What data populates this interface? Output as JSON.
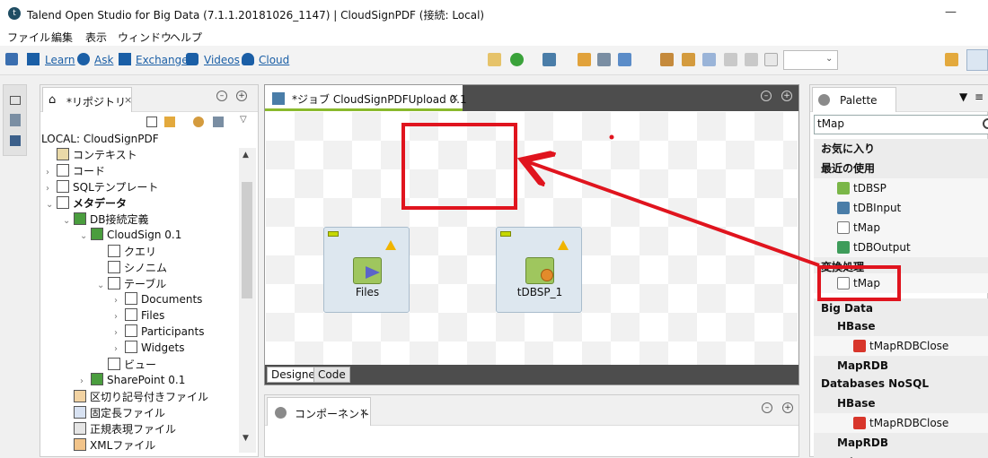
{
  "window": {
    "title": "Talend Open Studio for Big Data (7.1.1.20181026_1147) | CloudSignPDF (接続: Local)"
  },
  "menu": [
    "ファイル",
    "編集",
    "表示",
    "ウィンドウ",
    "ヘルプ"
  ],
  "toolbar": {
    "links": [
      "Learn",
      "Ask",
      "Exchange",
      "Videos",
      "Cloud"
    ]
  },
  "repository": {
    "tab_label": "*リポジトリ",
    "connection": "LOCAL: CloudSignPDF",
    "items": [
      {
        "label": "コンテキスト",
        "indent": 0,
        "arrow": "",
        "icon": "context-icon"
      },
      {
        "label": "コード",
        "indent": 0,
        "arrow": "›",
        "icon": "code-icon"
      },
      {
        "label": "SQLテンプレート",
        "indent": 0,
        "arrow": "›",
        "icon": "sql-template-icon"
      },
      {
        "label": "メタデータ",
        "indent": 0,
        "arrow": "⌄",
        "icon": "metadata-icon",
        "bold": true
      },
      {
        "label": "DB接続定義",
        "indent": 1,
        "arrow": "⌄",
        "icon": "db-connection-icon"
      },
      {
        "label": "CloudSign 0.1",
        "indent": 2,
        "arrow": "⌄",
        "icon": "db-connection-icon"
      },
      {
        "label": "クエリ",
        "indent": 3,
        "arrow": "",
        "icon": "folder-icon"
      },
      {
        "label": "シノニム",
        "indent": 3,
        "arrow": "",
        "icon": "folder-icon"
      },
      {
        "label": "テーブル",
        "indent": 3,
        "arrow": "⌄",
        "icon": "folder-icon"
      },
      {
        "label": "Documents",
        "indent": 4,
        "arrow": "›",
        "icon": "table-icon"
      },
      {
        "label": "Files",
        "indent": 4,
        "arrow": "›",
        "icon": "table-icon"
      },
      {
        "label": "Participants",
        "indent": 4,
        "arrow": "›",
        "icon": "table-icon"
      },
      {
        "label": "Widgets",
        "indent": 4,
        "arrow": "›",
        "icon": "table-icon"
      },
      {
        "label": "ビュー",
        "indent": 3,
        "arrow": "",
        "icon": "folder-icon"
      },
      {
        "label": "SharePoint 0.1",
        "indent": 2,
        "arrow": "›",
        "icon": "db-connection-icon"
      },
      {
        "label": "区切り記号付きファイル",
        "indent": 1,
        "arrow": "",
        "icon": "delimited-file-icon"
      },
      {
        "label": "固定長ファイル",
        "indent": 1,
        "arrow": "",
        "icon": "positional-file-icon"
      },
      {
        "label": "正規表現ファイル",
        "indent": 1,
        "arrow": "",
        "icon": "regex-file-icon"
      },
      {
        "label": "XMLファイル",
        "indent": 1,
        "arrow": "",
        "icon": "xml-file-icon"
      }
    ]
  },
  "editor": {
    "tab_label": "*ジョブ CloudSignPDFUpload 0.1",
    "components": [
      {
        "label": "Files"
      },
      {
        "label": "tDBSP_1"
      }
    ],
    "bottom_tabs": [
      "Designer",
      "Code"
    ]
  },
  "component_view": {
    "tab_label": "コンポーネント"
  },
  "palette": {
    "tab_label": "Palette",
    "search_value": "tMap",
    "rows": [
      {
        "kind": "hdr",
        "label": "お気に入り"
      },
      {
        "kind": "hdr",
        "label": "最近の使用"
      },
      {
        "kind": "item",
        "label": "tDBSP",
        "icon": "dbsp-icon"
      },
      {
        "kind": "item",
        "label": "tDBInput",
        "icon": "dbinput-icon"
      },
      {
        "kind": "item",
        "label": "tMap",
        "icon": "tmap-icon"
      },
      {
        "kind": "item",
        "label": "tDBOutput",
        "icon": "dboutput-icon"
      },
      {
        "kind": "hdr",
        "label": "変換処理"
      },
      {
        "kind": "item",
        "label": "tMap",
        "icon": "tmap-icon"
      },
      {
        "kind": "hdr",
        "label": "Big Data"
      },
      {
        "kind": "sub",
        "label": "HBase"
      },
      {
        "kind": "item2",
        "label": "tMapRDBClose",
        "icon": "maprdb-icon"
      },
      {
        "kind": "sub",
        "label": "MapRDB"
      },
      {
        "kind": "hdr",
        "label": "Databases NoSQL"
      },
      {
        "kind": "sub",
        "label": "HBase"
      },
      {
        "kind": "item2",
        "label": "tMapRDBClose",
        "icon": "maprdb-icon"
      },
      {
        "kind": "sub",
        "label": "MapRDB"
      },
      {
        "kind": "hdr",
        "label": "Databases"
      }
    ]
  },
  "colors": {
    "accent_green": "#8ab92d",
    "link_blue": "#1b5fa6",
    "annotation_red": "#e0141e"
  }
}
